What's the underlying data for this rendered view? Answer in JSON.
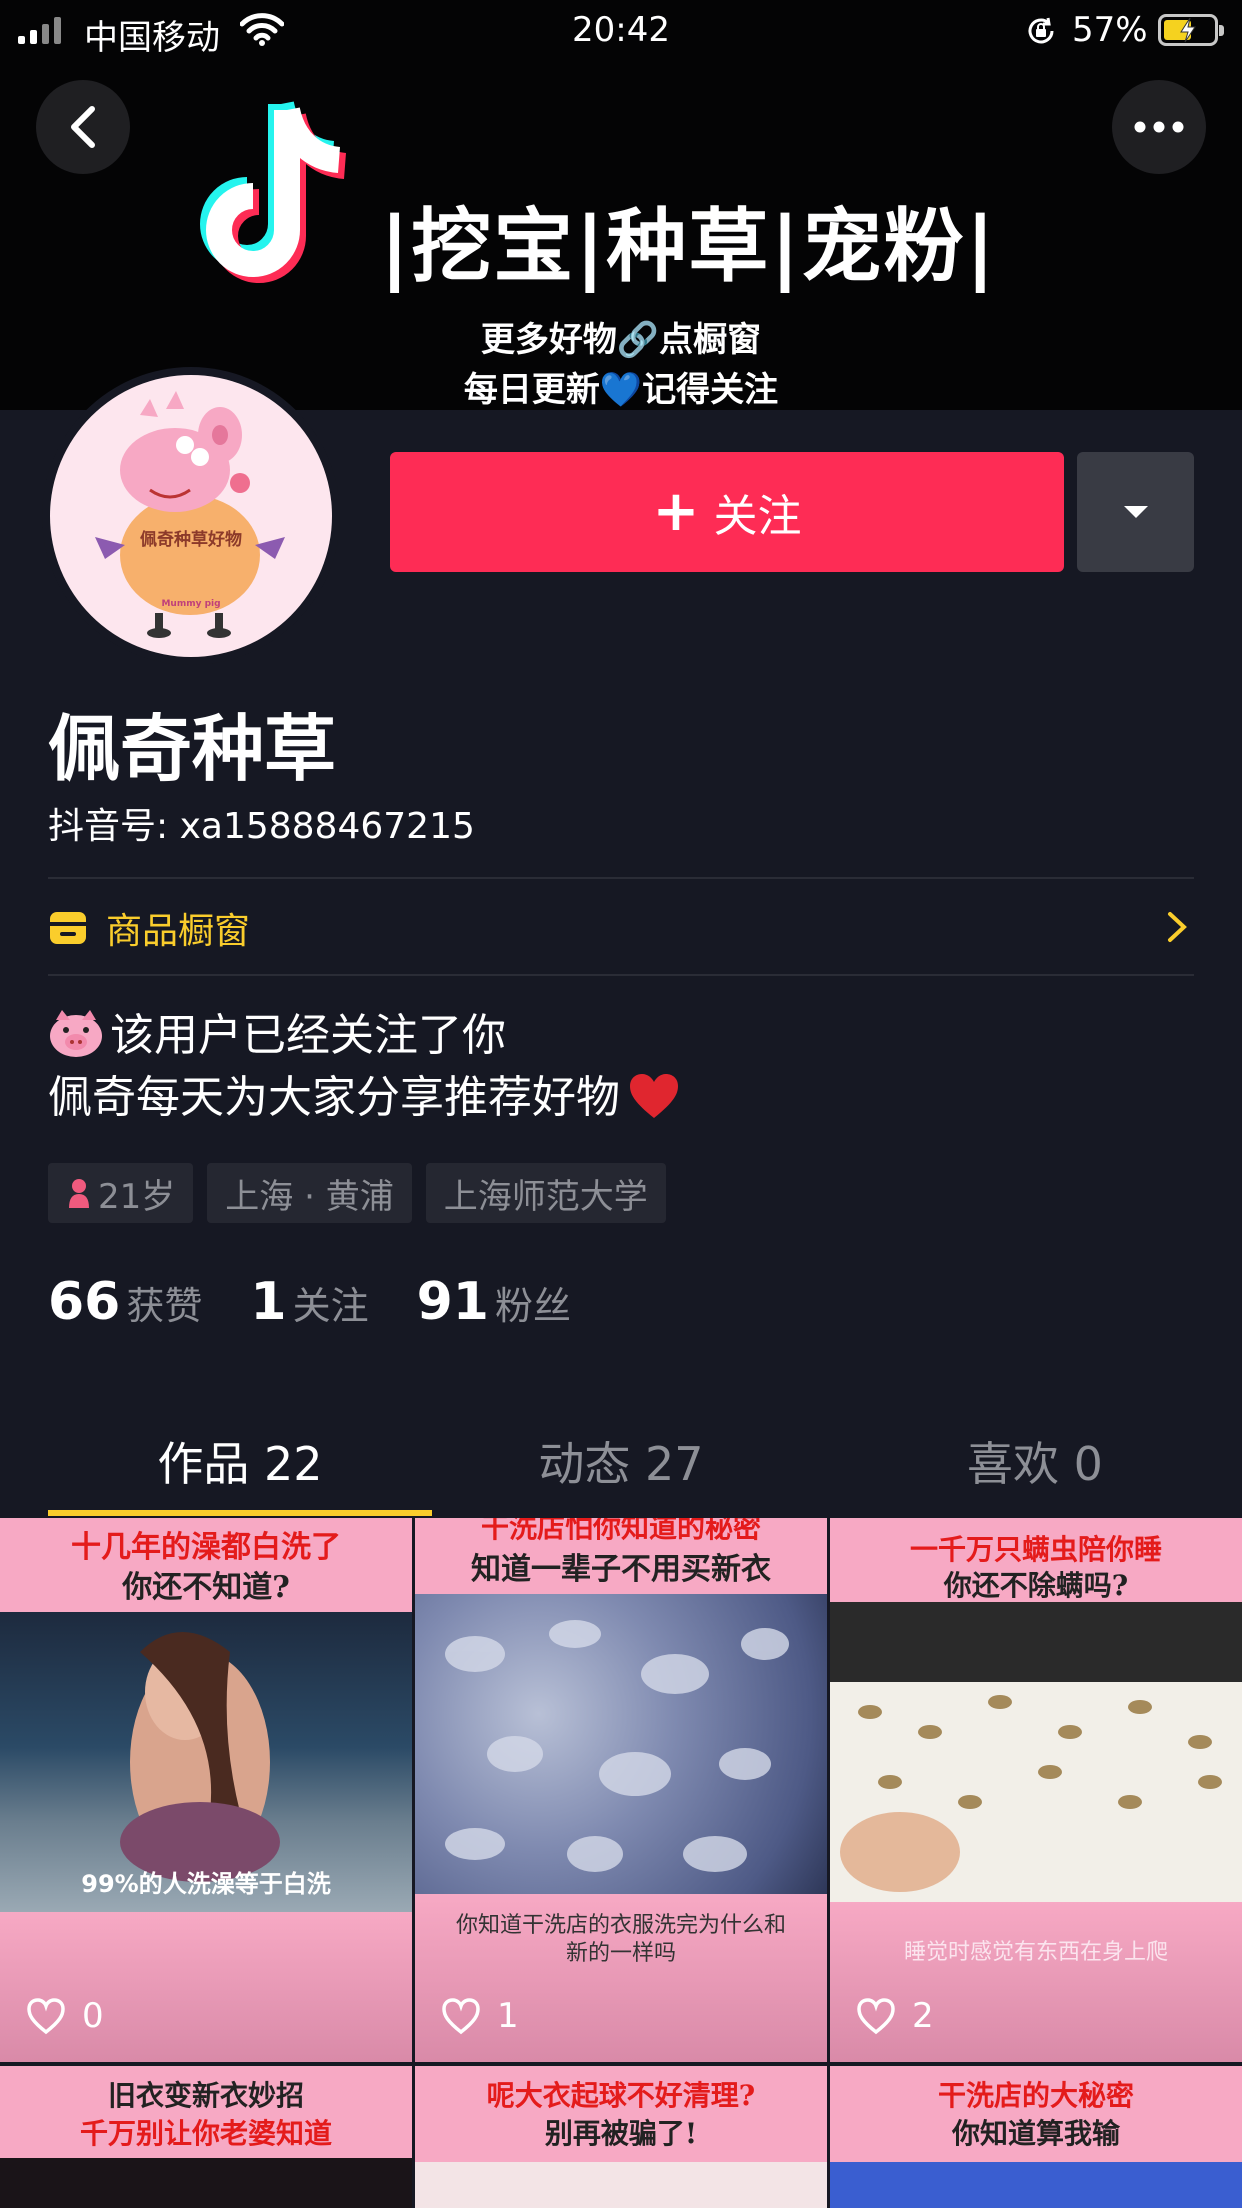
{
  "status_bar": {
    "carrier": "中国移动",
    "time": "20:42",
    "battery_percent": "57%",
    "battery_level": 0.57
  },
  "banner": {
    "slogan": "|挖宝|种草|宠粉|",
    "line1": "更多好物🔗点橱窗",
    "line2": "每日更新💙记得关注"
  },
  "avatar": {
    "text": "佩奇种草好物",
    "small_text": "Mummy pig"
  },
  "actions": {
    "follow_label": "关注"
  },
  "profile": {
    "nickname": "佩奇种草",
    "douyin_id": "抖音号: xa15888467215"
  },
  "shop": {
    "label": "商品橱窗"
  },
  "bio": {
    "line1": "该用户已经关注了你",
    "line2": "佩奇每天为大家分享推荐好物"
  },
  "tags": [
    {
      "label": "21岁"
    },
    {
      "label": "上海 · 黄浦"
    },
    {
      "label": "上海师范大学"
    }
  ],
  "stats": [
    {
      "num": "66",
      "label": "获赞"
    },
    {
      "num": "1",
      "label": "关注"
    },
    {
      "num": "91",
      "label": "粉丝"
    }
  ],
  "tabs": [
    {
      "label": "作品 22",
      "active": true
    },
    {
      "label": "动态 27",
      "active": false
    },
    {
      "label": "喜欢 0",
      "active": false
    }
  ],
  "videos": [
    {
      "cap1": "十几年的澡都白洗了",
      "cap2": "你还不知道?",
      "sub": "99%的人洗澡等于白洗",
      "likes": "0"
    },
    {
      "cap1": "干洗店怕你知道的秘密",
      "cap2": "知道一辈子不用买新衣",
      "sub": "你知道干洗店的衣服洗完为什么和新的一样吗",
      "likes": "1"
    },
    {
      "cap1": "一千万只螨虫陪你睡",
      "cap2": "你还不除螨吗?",
      "sub": "睡觉时感觉有东西在身上爬",
      "likes": "2"
    },
    {
      "cap1": "旧衣变新衣妙招",
      "cap2": "千万别让你老婆知道",
      "sub": "",
      "likes": ""
    },
    {
      "cap1": "呢大衣起球不好清理?",
      "cap2": "别再被骗了!",
      "sub": "",
      "likes": ""
    },
    {
      "cap1": "干洗店的大秘密",
      "cap2": "你知道算我输",
      "sub": "",
      "likes": ""
    }
  ],
  "colors": {
    "background": "#161823",
    "follow": "#fe2c55",
    "accent": "#facd2c"
  }
}
